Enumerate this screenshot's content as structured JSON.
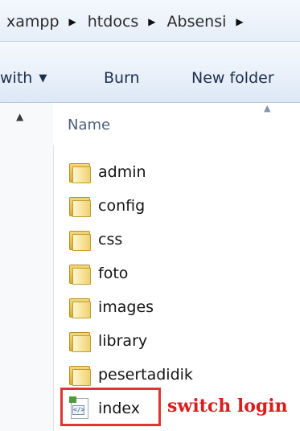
{
  "breadcrumb": {
    "items": [
      "xampp",
      "htdocs",
      "Absensi"
    ],
    "arrow_icon": "chevron-right-icon"
  },
  "toolbar": {
    "share_with_label": "with",
    "burn_label": "Burn",
    "new_folder_label": "New folder"
  },
  "columns": {
    "name_label": "Name"
  },
  "files": [
    {
      "name": "admin",
      "type": "folder"
    },
    {
      "name": "config",
      "type": "folder"
    },
    {
      "name": "css",
      "type": "folder"
    },
    {
      "name": "foto",
      "type": "folder"
    },
    {
      "name": "images",
      "type": "folder"
    },
    {
      "name": "library",
      "type": "folder"
    },
    {
      "name": "pesertadidik",
      "type": "folder"
    },
    {
      "name": "index",
      "type": "php-file"
    }
  ],
  "annotation": {
    "text": "switch login",
    "color": "#d91e1e"
  }
}
